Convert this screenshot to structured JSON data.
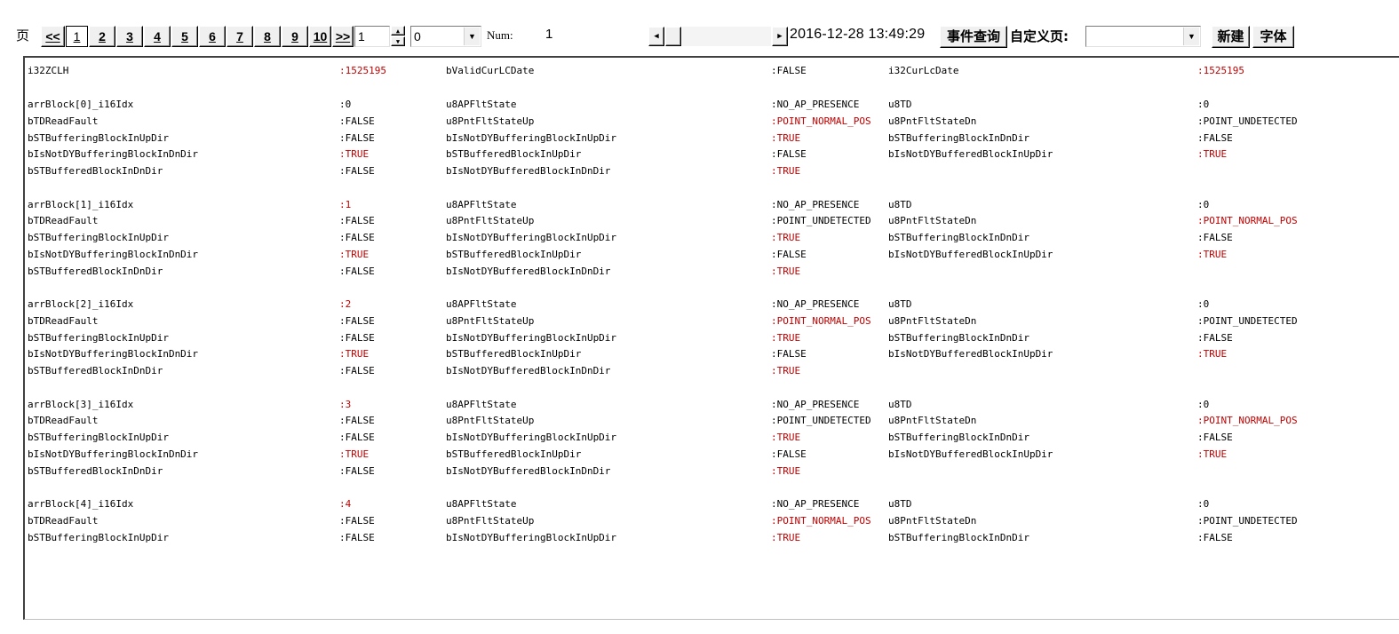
{
  "toolbar": {
    "page_label": "页",
    "prev_label": "<<",
    "pages": [
      "1",
      "2",
      "3",
      "4",
      "5",
      "6",
      "7",
      "8",
      "9",
      "10"
    ],
    "active_page": "1",
    "next_label": ">>",
    "page_input_value": "1",
    "select_value": "0",
    "num_label": "Num:",
    "num_value": "1",
    "scroll_left_icon": "arrow-left",
    "scroll_right_icon": "arrow-right",
    "datetime": "2016-12-28 13:49:29",
    "event_query_label": "事件查询",
    "custom_page_label": "自定义页:",
    "custom_page_value": "",
    "new_label": "新建",
    "font_label": "字体"
  },
  "colors": {
    "highlight": "#c00000",
    "normal": "#000000"
  },
  "header_row": [
    {
      "text": "i32ZCLH",
      "red": false
    },
    {
      "text": ":1525195",
      "red": true
    },
    {
      "text": "bValidCurLCDate",
      "red": false
    },
    {
      "text": ":FALSE",
      "red": false
    },
    {
      "text": "i32CurLcDate",
      "red": false
    },
    {
      "text": ":1525195",
      "red": true
    }
  ],
  "blocks": [
    {
      "rows": [
        [
          {
            "text": "arrBlock[0]_i16Idx",
            "red": false
          },
          {
            "text": ":0",
            "red": false
          },
          {
            "text": "u8APFltState",
            "red": false
          },
          {
            "text": ":NO_AP_PRESENCE",
            "red": false
          },
          {
            "text": "u8TD",
            "red": false
          },
          {
            "text": ":0",
            "red": false
          }
        ],
        [
          {
            "text": "bTDReadFault",
            "red": false
          },
          {
            "text": ":FALSE",
            "red": false
          },
          {
            "text": "u8PntFltStateUp",
            "red": false
          },
          {
            "text": ":POINT_NORMAL_POS",
            "red": true
          },
          {
            "text": "u8PntFltStateDn",
            "red": false
          },
          {
            "text": ":POINT_UNDETECTED",
            "red": false
          }
        ],
        [
          {
            "text": "bSTBufferingBlockInUpDir",
            "red": false
          },
          {
            "text": ":FALSE",
            "red": false
          },
          {
            "text": "bIsNotDYBufferingBlockInUpDir",
            "red": false
          },
          {
            "text": ":TRUE",
            "red": true
          },
          {
            "text": "bSTBufferingBlockInDnDir",
            "red": false
          },
          {
            "text": ":FALSE",
            "red": false
          }
        ],
        [
          {
            "text": "bIsNotDYBufferingBlockInDnDir",
            "red": false
          },
          {
            "text": ":TRUE",
            "red": true
          },
          {
            "text": "bSTBufferedBlockInUpDir",
            "red": false
          },
          {
            "text": ":FALSE",
            "red": false
          },
          {
            "text": "bIsNotDYBufferedBlockInUpDir",
            "red": false
          },
          {
            "text": ":TRUE",
            "red": true
          }
        ],
        [
          {
            "text": "bSTBufferedBlockInDnDir",
            "red": false
          },
          {
            "text": ":FALSE",
            "red": false
          },
          {
            "text": "bIsNotDYBufferedBlockInDnDir",
            "red": false
          },
          {
            "text": ":TRUE",
            "red": true
          },
          {
            "text": "",
            "red": false
          },
          {
            "text": "",
            "red": false
          }
        ]
      ]
    },
    {
      "rows": [
        [
          {
            "text": "arrBlock[1]_i16Idx",
            "red": false
          },
          {
            "text": ":1",
            "red": true
          },
          {
            "text": "u8APFltState",
            "red": false
          },
          {
            "text": ":NO_AP_PRESENCE",
            "red": false
          },
          {
            "text": "u8TD",
            "red": false
          },
          {
            "text": ":0",
            "red": false
          }
        ],
        [
          {
            "text": "bTDReadFault",
            "red": false
          },
          {
            "text": ":FALSE",
            "red": false
          },
          {
            "text": "u8PntFltStateUp",
            "red": false
          },
          {
            "text": ":POINT_UNDETECTED",
            "red": false
          },
          {
            "text": "u8PntFltStateDn",
            "red": false
          },
          {
            "text": ":POINT_NORMAL_POS",
            "red": true
          }
        ],
        [
          {
            "text": "bSTBufferingBlockInUpDir",
            "red": false
          },
          {
            "text": ":FALSE",
            "red": false
          },
          {
            "text": "bIsNotDYBufferingBlockInUpDir",
            "red": false
          },
          {
            "text": ":TRUE",
            "red": true
          },
          {
            "text": "bSTBufferingBlockInDnDir",
            "red": false
          },
          {
            "text": ":FALSE",
            "red": false
          }
        ],
        [
          {
            "text": "bIsNotDYBufferingBlockInDnDir",
            "red": false
          },
          {
            "text": ":TRUE",
            "red": true
          },
          {
            "text": "bSTBufferedBlockInUpDir",
            "red": false
          },
          {
            "text": ":FALSE",
            "red": false
          },
          {
            "text": "bIsNotDYBufferedBlockInUpDir",
            "red": false
          },
          {
            "text": ":TRUE",
            "red": true
          }
        ],
        [
          {
            "text": "bSTBufferedBlockInDnDir",
            "red": false
          },
          {
            "text": ":FALSE",
            "red": false
          },
          {
            "text": "bIsNotDYBufferedBlockInDnDir",
            "red": false
          },
          {
            "text": ":TRUE",
            "red": true
          },
          {
            "text": "",
            "red": false
          },
          {
            "text": "",
            "red": false
          }
        ]
      ]
    },
    {
      "rows": [
        [
          {
            "text": "arrBlock[2]_i16Idx",
            "red": false
          },
          {
            "text": ":2",
            "red": true
          },
          {
            "text": "u8APFltState",
            "red": false
          },
          {
            "text": ":NO_AP_PRESENCE",
            "red": false
          },
          {
            "text": "u8TD",
            "red": false
          },
          {
            "text": ":0",
            "red": false
          }
        ],
        [
          {
            "text": "bTDReadFault",
            "red": false
          },
          {
            "text": ":FALSE",
            "red": false
          },
          {
            "text": "u8PntFltStateUp",
            "red": false
          },
          {
            "text": ":POINT_NORMAL_POS",
            "red": true
          },
          {
            "text": "u8PntFltStateDn",
            "red": false
          },
          {
            "text": ":POINT_UNDETECTED",
            "red": false
          }
        ],
        [
          {
            "text": "bSTBufferingBlockInUpDir",
            "red": false
          },
          {
            "text": ":FALSE",
            "red": false
          },
          {
            "text": "bIsNotDYBufferingBlockInUpDir",
            "red": false
          },
          {
            "text": ":TRUE",
            "red": true
          },
          {
            "text": "bSTBufferingBlockInDnDir",
            "red": false
          },
          {
            "text": ":FALSE",
            "red": false
          }
        ],
        [
          {
            "text": "bIsNotDYBufferingBlockInDnDir",
            "red": false
          },
          {
            "text": ":TRUE",
            "red": true
          },
          {
            "text": "bSTBufferedBlockInUpDir",
            "red": false
          },
          {
            "text": ":FALSE",
            "red": false
          },
          {
            "text": "bIsNotDYBufferedBlockInUpDir",
            "red": false
          },
          {
            "text": ":TRUE",
            "red": true
          }
        ],
        [
          {
            "text": "bSTBufferedBlockInDnDir",
            "red": false
          },
          {
            "text": ":FALSE",
            "red": false
          },
          {
            "text": "bIsNotDYBufferedBlockInDnDir",
            "red": false
          },
          {
            "text": ":TRUE",
            "red": true
          },
          {
            "text": "",
            "red": false
          },
          {
            "text": "",
            "red": false
          }
        ]
      ]
    },
    {
      "rows": [
        [
          {
            "text": "arrBlock[3]_i16Idx",
            "red": false
          },
          {
            "text": ":3",
            "red": true
          },
          {
            "text": "u8APFltState",
            "red": false
          },
          {
            "text": ":NO_AP_PRESENCE",
            "red": false
          },
          {
            "text": "u8TD",
            "red": false
          },
          {
            "text": ":0",
            "red": false
          }
        ],
        [
          {
            "text": "bTDReadFault",
            "red": false
          },
          {
            "text": ":FALSE",
            "red": false
          },
          {
            "text": "u8PntFltStateUp",
            "red": false
          },
          {
            "text": ":POINT_UNDETECTED",
            "red": false
          },
          {
            "text": "u8PntFltStateDn",
            "red": false
          },
          {
            "text": ":POINT_NORMAL_POS",
            "red": true
          }
        ],
        [
          {
            "text": "bSTBufferingBlockInUpDir",
            "red": false
          },
          {
            "text": ":FALSE",
            "red": false
          },
          {
            "text": "bIsNotDYBufferingBlockInUpDir",
            "red": false
          },
          {
            "text": ":TRUE",
            "red": true
          },
          {
            "text": "bSTBufferingBlockInDnDir",
            "red": false
          },
          {
            "text": ":FALSE",
            "red": false
          }
        ],
        [
          {
            "text": "bIsNotDYBufferingBlockInDnDir",
            "red": false
          },
          {
            "text": ":TRUE",
            "red": true
          },
          {
            "text": "bSTBufferedBlockInUpDir",
            "red": false
          },
          {
            "text": ":FALSE",
            "red": false
          },
          {
            "text": "bIsNotDYBufferedBlockInUpDir",
            "red": false
          },
          {
            "text": ":TRUE",
            "red": true
          }
        ],
        [
          {
            "text": "bSTBufferedBlockInDnDir",
            "red": false
          },
          {
            "text": ":FALSE",
            "red": false
          },
          {
            "text": "bIsNotDYBufferedBlockInDnDir",
            "red": false
          },
          {
            "text": ":TRUE",
            "red": true
          },
          {
            "text": "",
            "red": false
          },
          {
            "text": "",
            "red": false
          }
        ]
      ]
    },
    {
      "rows": [
        [
          {
            "text": "arrBlock[4]_i16Idx",
            "red": false
          },
          {
            "text": ":4",
            "red": true
          },
          {
            "text": "u8APFltState",
            "red": false
          },
          {
            "text": ":NO_AP_PRESENCE",
            "red": false
          },
          {
            "text": "u8TD",
            "red": false
          },
          {
            "text": ":0",
            "red": false
          }
        ],
        [
          {
            "text": "bTDReadFault",
            "red": false
          },
          {
            "text": ":FALSE",
            "red": false
          },
          {
            "text": "u8PntFltStateUp",
            "red": false
          },
          {
            "text": ":POINT_NORMAL_POS",
            "red": true
          },
          {
            "text": "u8PntFltStateDn",
            "red": false
          },
          {
            "text": ":POINT_UNDETECTED",
            "red": false
          }
        ],
        [
          {
            "text": "bSTBufferingBlockInUpDir",
            "red": false
          },
          {
            "text": ":FALSE",
            "red": false
          },
          {
            "text": "bIsNotDYBufferingBlockInUpDir",
            "red": false
          },
          {
            "text": ":TRUE",
            "red": true
          },
          {
            "text": "bSTBufferingBlockInDnDir",
            "red": false
          },
          {
            "text": ":FALSE",
            "red": false
          }
        ]
      ]
    }
  ]
}
